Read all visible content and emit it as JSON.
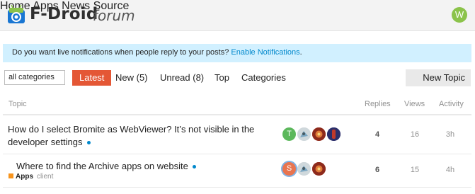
{
  "header": {
    "brand": "F-Droid",
    "brand_sub": "forum",
    "nav": [
      "Home",
      "Apps",
      "News",
      "Source"
    ],
    "user_initial": "W"
  },
  "banner": {
    "text": "Do you want live notifications when people reply to your posts? ",
    "link": "Enable Notifications",
    "after": "."
  },
  "filters": {
    "category_select": "all categories",
    "tabs": [
      "Latest",
      "New (5)",
      "Unread (8)",
      "Top",
      "Categories"
    ],
    "new_topic": "New Topic"
  },
  "list": {
    "columns": [
      "Topic",
      "Replies",
      "Views",
      "Activity"
    ],
    "topics": [
      {
        "title": "How do I select Bromite as WebViewer? It’s not visible in the developer settings",
        "replies": "4",
        "views": "16",
        "activity": "3h",
        "posters": [
          "T",
          "",
          "",
          ""
        ]
      },
      {
        "title": "Where to find the Archive apps on website",
        "category": "Apps",
        "tag": "client",
        "replies": "6",
        "views": "15",
        "activity": "4h",
        "posters": [
          "S",
          "",
          ""
        ]
      }
    ]
  },
  "colors": {
    "accent": "#e45735",
    "link": "#0088cc",
    "banner_bg": "#d1f0ff",
    "category_apps": "#f7941d",
    "avatar_user": "#8bc34a"
  }
}
